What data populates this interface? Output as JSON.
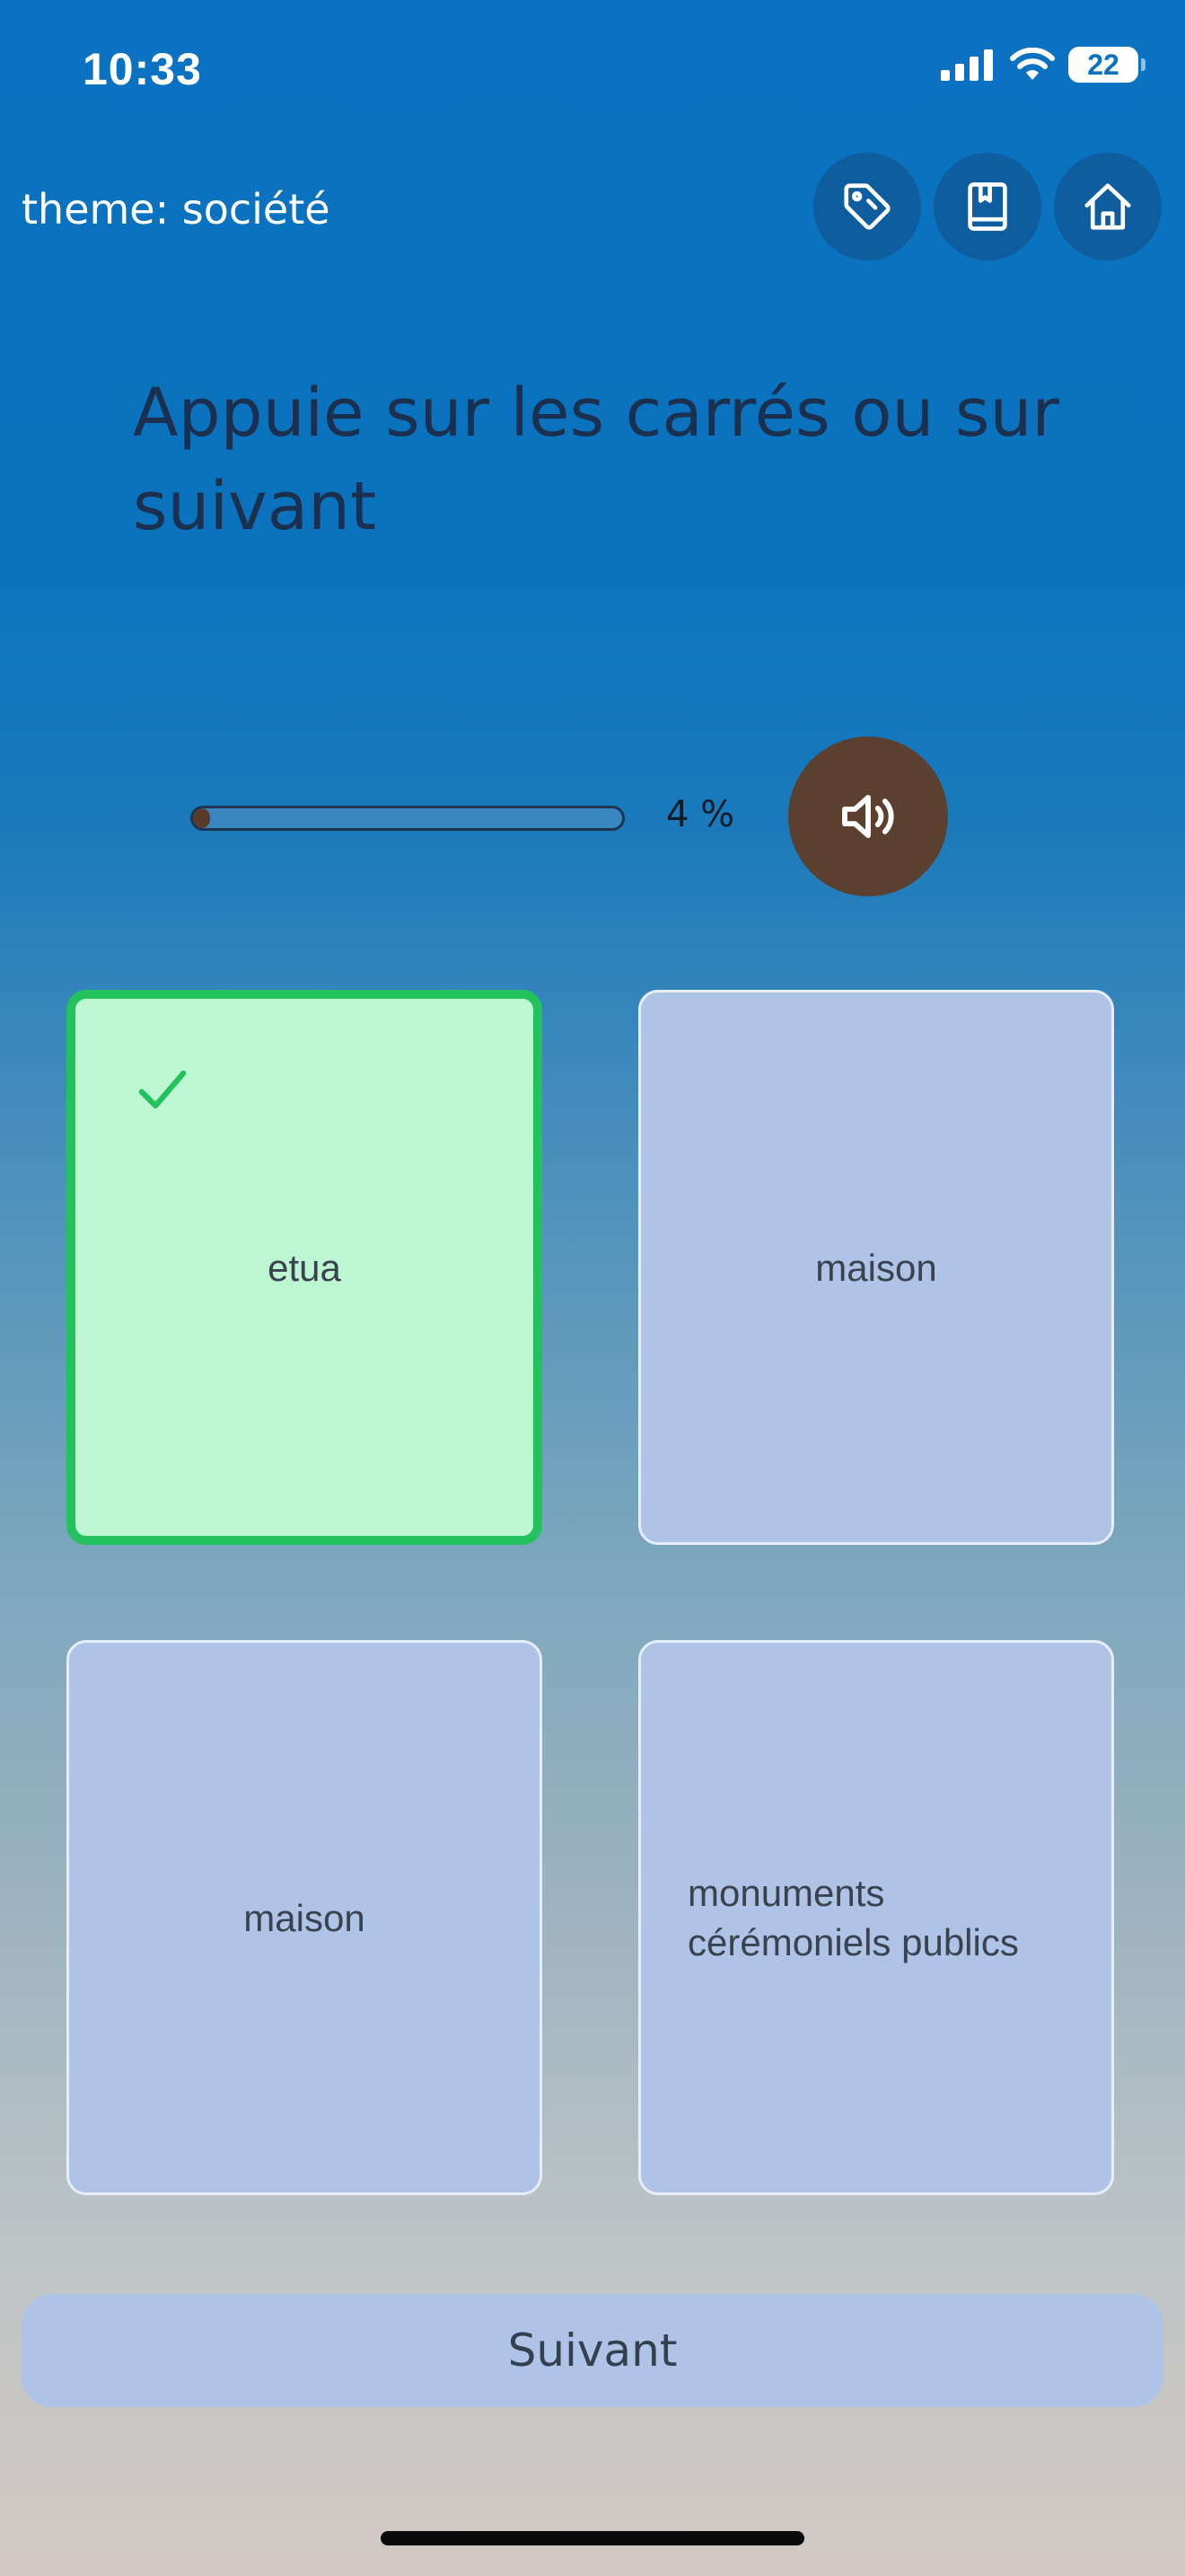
{
  "status_bar": {
    "time": "10:33",
    "battery": "22",
    "icons": [
      "signal-icon",
      "wifi-icon",
      "battery-icon"
    ]
  },
  "header": {
    "theme_label": "theme: société",
    "buttons": [
      {
        "icon": "tag-icon"
      },
      {
        "icon": "book-icon"
      },
      {
        "icon": "home-icon"
      }
    ]
  },
  "prompt": "Appuie sur les carrés ou sur suivant",
  "progress": {
    "value_percent": 4,
    "label": "4 %"
  },
  "sound_button": {
    "icon": "speaker-icon"
  },
  "cards": [
    {
      "text": "etua",
      "selected": true,
      "status": "correct"
    },
    {
      "text": "maison",
      "selected": false
    },
    {
      "text": "maison",
      "selected": false
    },
    {
      "text": "monuments cérémoniels publics",
      "selected": false
    }
  ],
  "next_button": {
    "label": "Suivant"
  },
  "colors": {
    "background_top": "#0a72c0",
    "card": "#aec3e6",
    "card_selected": "#bdf6d2",
    "card_selected_border": "#24c25d",
    "sound_button": "#5b4030",
    "progress_fill": "#5a3a2a"
  }
}
